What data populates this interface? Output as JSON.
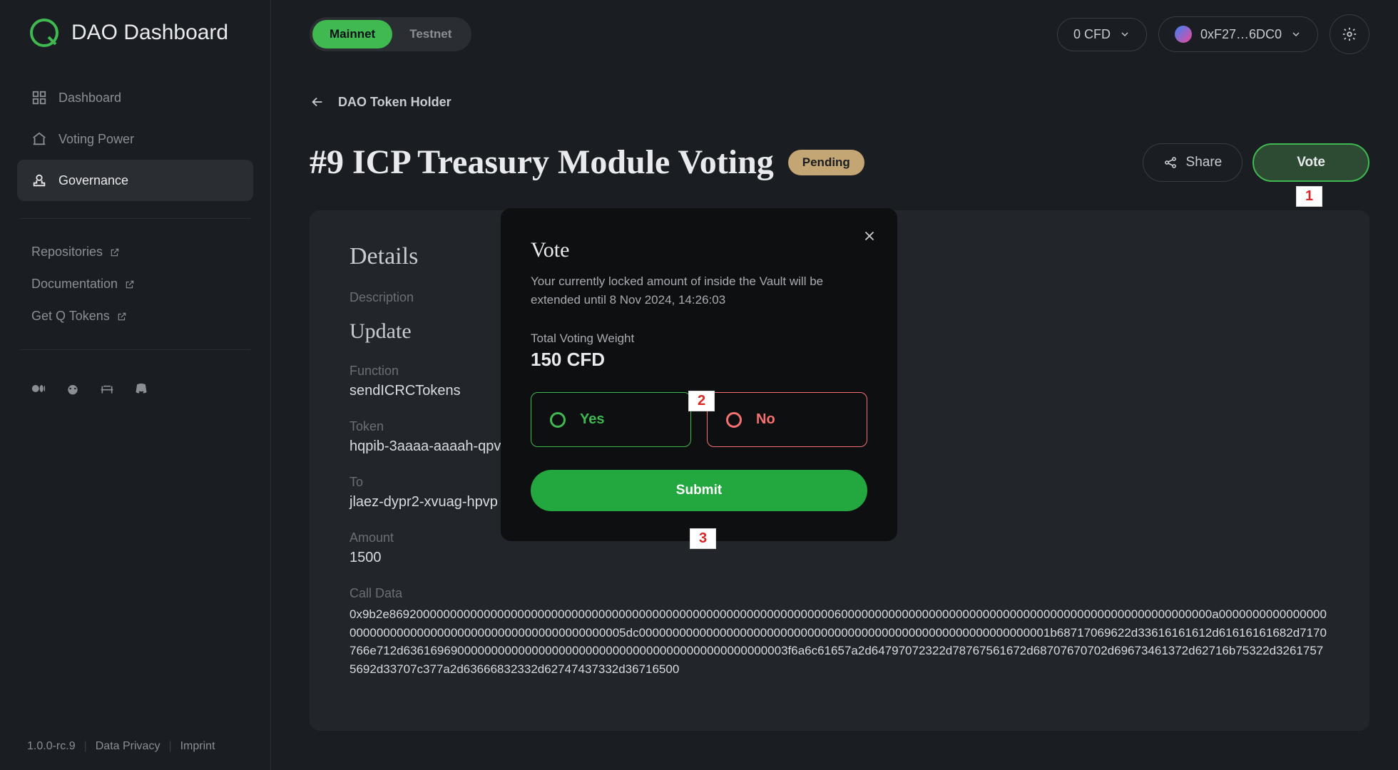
{
  "brand": "DAO Dashboard",
  "network": {
    "mainnet": "Mainnet",
    "testnet": "Testnet"
  },
  "topbar": {
    "balance": "0 CFD",
    "wallet": "0xF27…6DC0"
  },
  "sidebar": {
    "items": [
      {
        "label": "Dashboard"
      },
      {
        "label": "Voting Power"
      },
      {
        "label": "Governance"
      }
    ],
    "ext": [
      {
        "label": "Repositories"
      },
      {
        "label": "Documentation"
      },
      {
        "label": "Get Q Tokens"
      }
    ],
    "footer": {
      "version": "1.0.0-rc.9",
      "privacy": "Data Privacy",
      "imprint": "Imprint"
    }
  },
  "page": {
    "back": "DAO Token Holder",
    "title": "#9 ICP Treasury Module Voting",
    "status": "Pending",
    "share": "Share",
    "vote": "Vote"
  },
  "details": {
    "heading": "Details",
    "description_label": "Description",
    "update_heading": "Update",
    "function_label": "Function",
    "function_value": "sendICRCTokens",
    "token_label": "Token",
    "token_value": "hqpib-3aaaa-aaaah-qpv",
    "to_label": "To",
    "to_value": "jlaez-dypr2-xvuag-hpvp",
    "amount_label": "Amount",
    "amount_value": "1500",
    "calldata_label": "Call Data",
    "calldata_value": "0x9b2e86920000000000000000000000000000000000000000000000000000000000000060000000000000000000000000000000000000000000000000000000a000000000000000000000000000000000000000000000000000000005dc0000000000000000000000000000000000000000000000000000000000001b68717069622d33616161612d61616161682d7170766e712d636169690000000000000000000000000000000000000000000000003f6a6c61657a2d64797072322d78767561672d68707670702d69673461372d62716b75322d32617575692d33707c377a2d63666832332d62747437332d36716500"
  },
  "modal": {
    "title": "Vote",
    "sub": "Your currently locked amount of inside the Vault will be extended until 8 Nov 2024, 14:26:03",
    "weight_label": "Total Voting Weight",
    "weight_value": "150 CFD",
    "yes": "Yes",
    "no": "No",
    "submit": "Submit"
  },
  "markers": {
    "m1": "1",
    "m2": "2",
    "m3": "3"
  }
}
